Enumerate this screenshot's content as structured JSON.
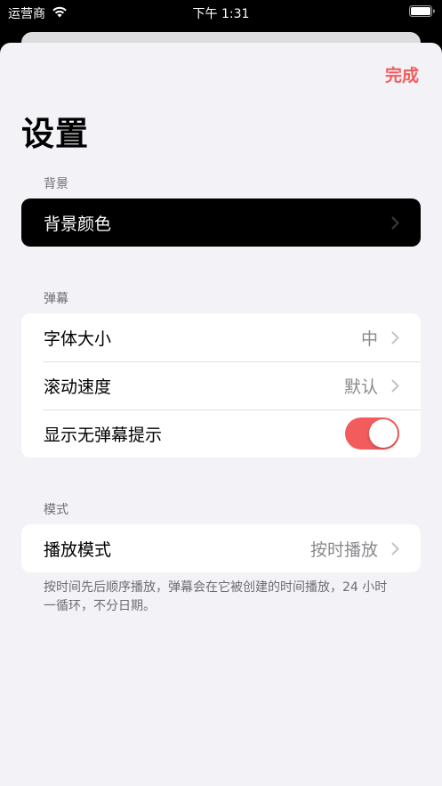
{
  "status_bar": {
    "carrier": "运营商",
    "time": "下午 1:31",
    "wifi_icon": "wifi-icon",
    "battery_icon": "battery-icon"
  },
  "sheet": {
    "done_label": "完成",
    "title": "设置"
  },
  "sections": {
    "background": {
      "header": "背景",
      "rows": [
        {
          "label": "背景颜色",
          "value": "",
          "accessory": "chevron"
        }
      ]
    },
    "danmaku": {
      "header": "弹幕",
      "rows": [
        {
          "label": "字体大小",
          "value": "中",
          "accessory": "chevron"
        },
        {
          "label": "滚动速度",
          "value": "默认",
          "accessory": "chevron"
        },
        {
          "label": "显示无弹幕提示",
          "value": "",
          "accessory": "toggle",
          "on": true
        }
      ]
    },
    "mode": {
      "header": "模式",
      "rows": [
        {
          "label": "播放模式",
          "value": "按时播放",
          "accessory": "chevron"
        }
      ],
      "footer": "按时间先后顺序播放，弹幕会在它被创建的时间播放，24 小时一循环，不分日期。"
    }
  },
  "colors": {
    "accent": "#f25c5c",
    "background": "#f2f2f7",
    "cell": "#ffffff",
    "secondary_text": "#8a8a8e"
  }
}
